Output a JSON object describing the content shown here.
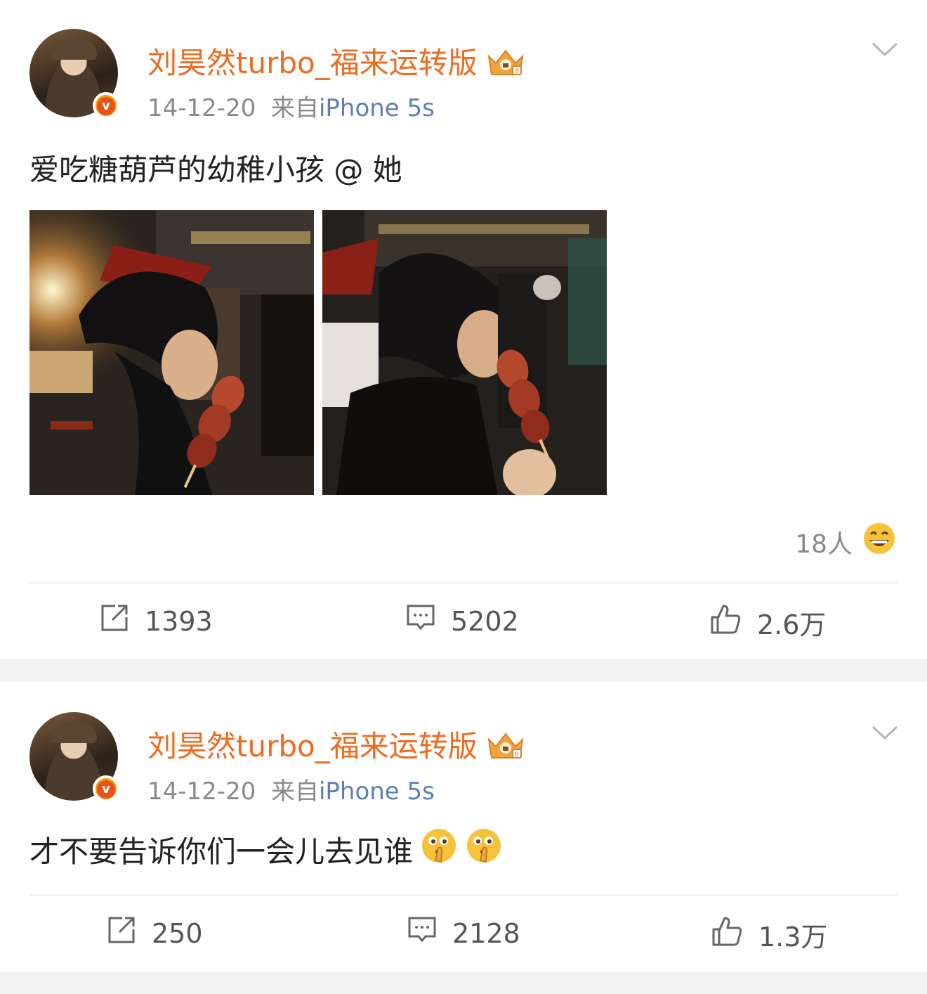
{
  "posts": [
    {
      "username": "刘昊然turbo_福来运转版",
      "date": "14-12-20",
      "from_prefix": "来自",
      "source": "iPhone 5s",
      "text": "爱吃糖葫芦的幼稚小孩 @ 她",
      "reaction_count": "18人",
      "reaction_icon": "grinning-emoji-icon",
      "repost_count": "1393",
      "comment_count": "5202",
      "like_count": "2.6万"
    },
    {
      "username": "刘昊然turbo_福来运转版",
      "date": "14-12-20",
      "from_prefix": "来自",
      "source": "iPhone 5s",
      "text": "才不要告诉你们一会儿去见谁",
      "text_emojis": [
        "shushing-face-icon",
        "shushing-face-icon"
      ],
      "repost_count": "250",
      "comment_count": "2128",
      "like_count": "1.3万"
    }
  ],
  "colors": {
    "username": "#ef6b1f",
    "source_link": "#5d7fb3",
    "meta": "#8a8a8a",
    "verified_badge": "#f1a400"
  }
}
